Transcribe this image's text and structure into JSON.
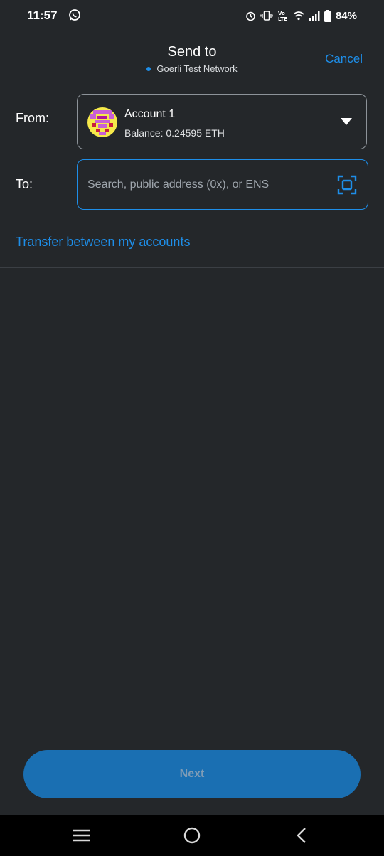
{
  "status_bar": {
    "time": "11:57",
    "battery": "84%",
    "icons": [
      "whatsapp-icon",
      "alarm-icon",
      "vibrate-icon",
      "volte-icon",
      "wifi-icon",
      "signal-icon",
      "battery-icon"
    ]
  },
  "header": {
    "title": "Send to",
    "network": "Goerli Test Network",
    "cancel_label": "Cancel"
  },
  "from": {
    "label": "From:",
    "account_name": "Account 1",
    "balance": "Balance: 0.24595 ETH"
  },
  "to": {
    "label": "To:",
    "placeholder": "Search, public address (0x), or ENS"
  },
  "transfer_link": "Transfer between my accounts",
  "next_label": "Next",
  "colors": {
    "background": "#24272a",
    "accent": "#1e8ee8",
    "button": "#1a6fb2"
  }
}
